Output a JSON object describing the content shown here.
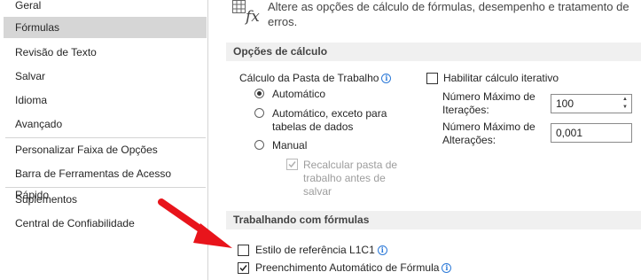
{
  "sidebar": {
    "items": [
      {
        "label": "Geral"
      },
      {
        "label": "Fórmulas",
        "selected": true
      },
      {
        "label": "Revisão de Texto"
      },
      {
        "label": "Salvar"
      },
      {
        "label": "Idioma"
      },
      {
        "label": "Avançado"
      },
      {
        "label": "Personalizar Faixa de Opções"
      },
      {
        "label": "Barra de Ferramentas de Acesso Rápido"
      },
      {
        "label": "Suplementos"
      },
      {
        "label": "Central de Confiabilidade"
      }
    ]
  },
  "intro": {
    "line1": "Altere as opções de cálculo de fórmulas, desempenho e tratamento de",
    "line2": "erros."
  },
  "calc_options": {
    "header": "Opções de cálculo",
    "workbook_label": "Cálculo da Pasta de Trabalho",
    "radio_auto": "Automático",
    "radio_auto_except_1": "Automático, exceto para",
    "radio_auto_except_2": "tabelas de dados",
    "radio_manual": "Manual",
    "recalc_1": "Recalcular pasta de",
    "recalc_2": "trabalho antes de",
    "recalc_3": "salvar",
    "iterative_label": "Habilitar cálculo iterativo",
    "max_iter_1": "Número Máximo de",
    "max_iter_2": "Iterações:",
    "max_iter_value": "100",
    "max_change_1": "Número Máximo de",
    "max_change_2": "Alterações:",
    "max_change_value": "0,001",
    "selected_mode": "Automático",
    "iterative_checked": false,
    "recalc_checked": true
  },
  "formulas_section": {
    "header": "Trabalhando com fórmulas",
    "r1c1_label": "Estilo de referência L1C1",
    "r1c1_checked": false,
    "autocomplete_label": "Preenchimento Automático de Fórmula",
    "autocomplete_checked": true
  },
  "colors": {
    "arrow": "#e8141b",
    "info": "#2b79d8",
    "selected_bg": "#d6d6d6"
  }
}
